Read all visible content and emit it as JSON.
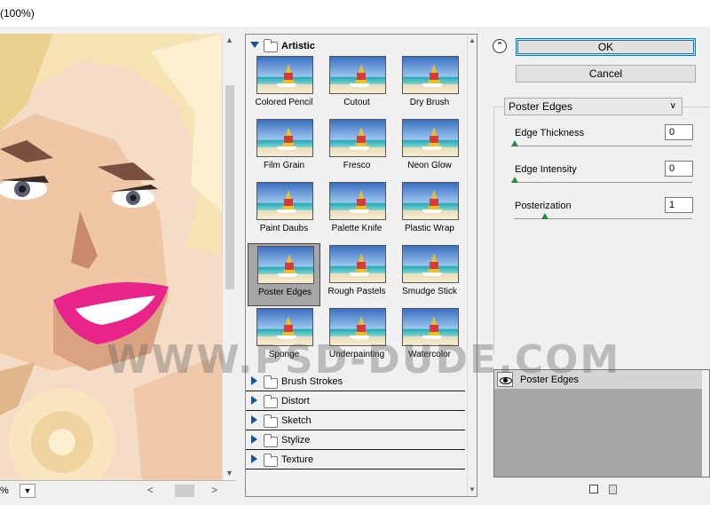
{
  "window": {
    "title_partial": "(100%)"
  },
  "preview": {
    "zoom": "%",
    "zoom_dropdown_icon": "chevron-down-icon"
  },
  "gallery": {
    "open_category": "Artistic",
    "filters": [
      {
        "label": "Colored Pencil",
        "selected": false
      },
      {
        "label": "Cutout",
        "selected": false
      },
      {
        "label": "Dry Brush",
        "selected": false
      },
      {
        "label": "Film Grain",
        "selected": false
      },
      {
        "label": "Fresco",
        "selected": false
      },
      {
        "label": "Neon Glow",
        "selected": false
      },
      {
        "label": "Paint Daubs",
        "selected": false
      },
      {
        "label": "Palette Knife",
        "selected": false
      },
      {
        "label": "Plastic Wrap",
        "selected": false
      },
      {
        "label": "Poster Edges",
        "selected": true
      },
      {
        "label": "Rough Pastels",
        "selected": false
      },
      {
        "label": "Smudge Stick",
        "selected": false
      },
      {
        "label": "Sponge",
        "selected": false
      },
      {
        "label": "Underpainting",
        "selected": false
      },
      {
        "label": "Watercolor",
        "selected": false
      }
    ],
    "collapsed_categories": [
      "Brush Strokes",
      "Distort",
      "Sketch",
      "Stylize",
      "Texture"
    ]
  },
  "buttons": {
    "ok": "OK",
    "cancel": "Cancel"
  },
  "filter_select": {
    "value": "Poster Edges"
  },
  "params": [
    {
      "label": "Edge Thickness",
      "value": "0",
      "fraction": 0.0
    },
    {
      "label": "Edge Intensity",
      "value": "0",
      "fraction": 0.0
    },
    {
      "label": "Posterization",
      "value": "1",
      "fraction": 0.17
    }
  ],
  "layers": {
    "items": [
      {
        "name": "Poster Edges"
      }
    ]
  },
  "watermark": "WWW.PSD-DUDE.COM",
  "colors": {
    "accent": "#0078d7",
    "panel_gray": "#a5a5a5",
    "disclosure": "#1a4fa0"
  }
}
